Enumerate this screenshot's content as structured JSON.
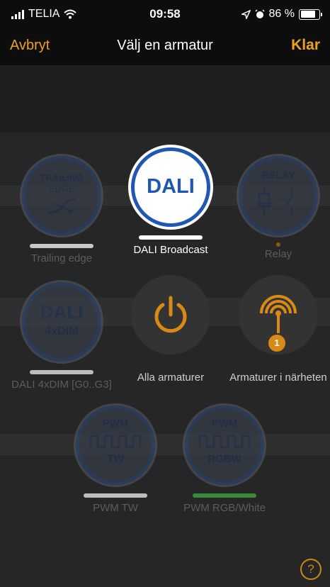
{
  "status_bar": {
    "carrier": "TELIA",
    "time": "09:58",
    "battery": "86 %"
  },
  "nav": {
    "cancel_label": "Avbryt",
    "title": "Välj en armatur",
    "done_label": "Klar"
  },
  "fixtures": [
    {
      "label": "Trailing edge",
      "icon_lines": [
        "TRAILING",
        "EDGE"
      ],
      "state": "dim",
      "bar_color": "#c8c8c8"
    },
    {
      "label": "DALI Broadcast",
      "icon_text": "DALI",
      "state": "selected",
      "bar_color": "#ffffff"
    },
    {
      "label": "Relay",
      "icon_text": "RELAY",
      "state": "dim",
      "indicator_color": "#8a5a18"
    },
    {
      "label": "DALI 4xDIM [G0..G3]",
      "icon_lines": [
        "DALI",
        "4xDIM"
      ],
      "state": "dim",
      "bar_color": "#bdbdbd"
    },
    {
      "label": "Alla armaturer",
      "icon": "power-icon",
      "state": "normal"
    },
    {
      "label": "Armaturer i närheten",
      "icon": "proximity-icon",
      "badge": "1",
      "state": "normal"
    },
    {
      "label": "PWM TW",
      "icon_lines": [
        "PWM",
        "TW"
      ],
      "state": "dim",
      "bar_color": "#bdbdbd"
    },
    {
      "label": "PWM RGB/White",
      "icon_lines": [
        "PWM",
        "RGBW"
      ],
      "state": "dim",
      "bar_color": "#3a8a3a"
    }
  ],
  "help_label": "?",
  "colors": {
    "accent": "#f0a020",
    "dali_blue": "#1f57b3"
  }
}
